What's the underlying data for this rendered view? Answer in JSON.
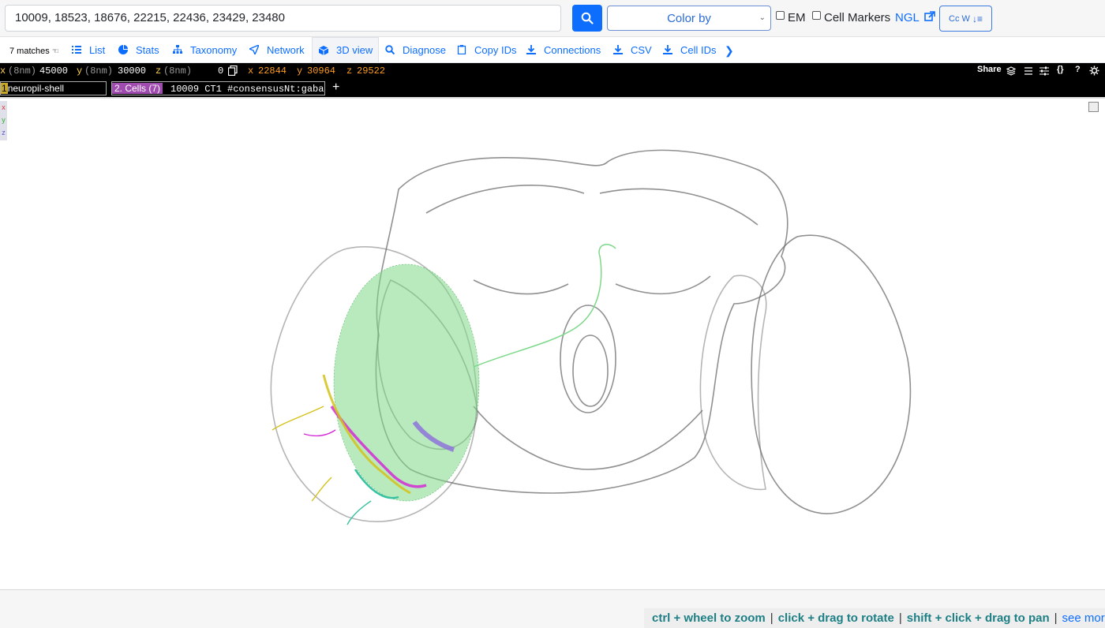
{
  "search": {
    "query": "10009, 18523, 18676, 22215, 22436, 23429, 23480"
  },
  "toolbar": {
    "color_by": "Color by",
    "em_label": "EM",
    "em_checked": false,
    "cell_markers_label": "Cell Markers",
    "cell_markers_checked": false,
    "ngl_label": "NGL",
    "ccw_label": "Cc W"
  },
  "tabs": {
    "matches": "7 matches",
    "items": [
      {
        "label": "List",
        "icon": "list-icon"
      },
      {
        "label": "Stats",
        "icon": "pie-chart-icon"
      },
      {
        "label": "Taxonomy",
        "icon": "hierarchy-icon"
      },
      {
        "label": "Network",
        "icon": "send-icon"
      },
      {
        "label": "3D view",
        "icon": "cube-icon",
        "active": true
      },
      {
        "label": "Diagnose",
        "icon": "magnifier-icon"
      },
      {
        "label": "Copy IDs",
        "icon": "clipboard-icon"
      },
      {
        "label": "Connections",
        "icon": "download-icon"
      },
      {
        "label": "CSV",
        "icon": "download-icon"
      },
      {
        "label": "Cell IDs",
        "icon": "download-icon"
      }
    ]
  },
  "coords": {
    "x_label": "x",
    "y_label": "y",
    "z_label": "z",
    "unit": "(8nm)",
    "x": "45000",
    "y": "30000",
    "z": "",
    "zero": "0",
    "cx": "22844",
    "cy": "30964",
    "cz": "29522",
    "share": "Share"
  },
  "layers": {
    "layer1_num": "1",
    "layer1_name": "neuropil-shell",
    "layer2_tag": "2. Cells (7)",
    "layer2_name": "10009 CT1 #consensusNt:gaba",
    "add": "+"
  },
  "axes": [
    "x",
    "y",
    "z"
  ],
  "hints": {
    "zoom": "ctrl + wheel to zoom",
    "rotate": "click + drag to rotate",
    "pan": "shift + click + drag to pan",
    "more": "see more"
  },
  "colors": {
    "accent": "#0d6efd",
    "neuron_green": "#7dd889",
    "neuron_magenta": "#d42bd6",
    "neuron_yellow": "#d4c21a",
    "neuron_purple": "#8c6bdc",
    "neuron_teal": "#39c2a1"
  }
}
